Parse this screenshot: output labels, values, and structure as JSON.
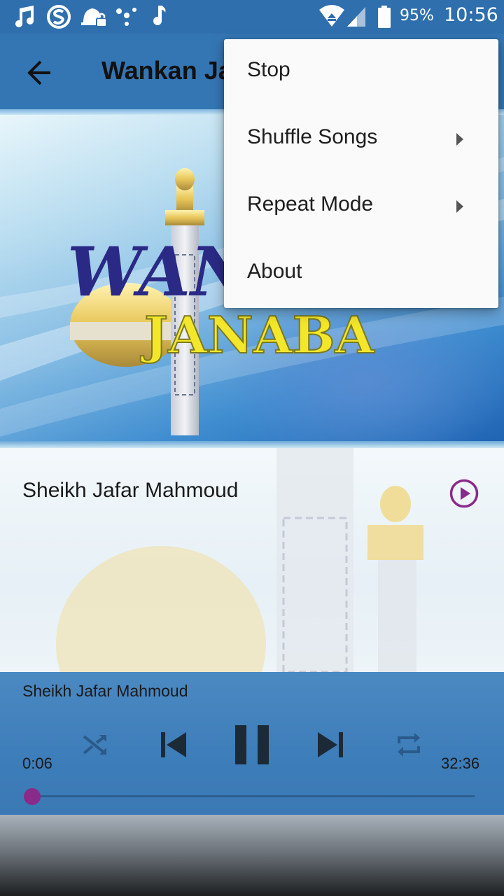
{
  "status_bar": {
    "battery_percent": "95%",
    "time": "10:56",
    "icons": [
      "music-note-icon",
      "swiftkey-icon",
      "alarm-lock-icon",
      "dots-icon",
      "music-note-icon",
      "wifi-icon",
      "signal-icon",
      "battery-icon"
    ]
  },
  "app_bar": {
    "title": "Wankan Janaba",
    "back_icon": "arrow-left-icon"
  },
  "banner": {
    "logo_text_top": "WANKAN",
    "logo_text_bottom": "JANABA"
  },
  "track_list": {
    "items": [
      {
        "title": "Sheikh Jafar Mahmoud",
        "action_icon": "play-circle-icon"
      }
    ]
  },
  "player": {
    "now_playing": "Sheikh Jafar Mahmoud",
    "current_time": "0:06",
    "total_time": "32:36",
    "progress_fraction": 0.003,
    "controls": [
      "shuffle-icon",
      "previous-icon",
      "pause-icon",
      "next-icon",
      "repeat-icon"
    ]
  },
  "menu": {
    "items": [
      {
        "label": "Stop",
        "has_submenu": false
      },
      {
        "label": "Shuffle Songs",
        "has_submenu": true
      },
      {
        "label": "Repeat Mode",
        "has_submenu": true
      },
      {
        "label": "About",
        "has_submenu": false
      }
    ]
  },
  "colors": {
    "primary": "#3476b4",
    "accent": "#8a2a8a",
    "logo_navy": "#2a2a86",
    "logo_yellow": "#f4e62a"
  }
}
